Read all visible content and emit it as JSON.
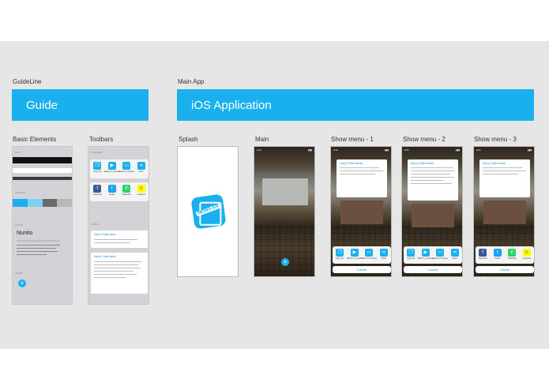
{
  "sections": {
    "guideline_label": "GuideLine",
    "mainapp_label": "Main App"
  },
  "banners": {
    "guide": "Guide",
    "ios": "iOS Application"
  },
  "columns": {
    "basic_elements": "Basic Elements",
    "toolbars": "Toolbars",
    "splash": "Splash",
    "main": "Main",
    "show1": "Show menu - 1",
    "show2": "Show menu - 2",
    "show3": "Show menu - 3"
  },
  "basic": {
    "bar_label": "BAR",
    "colors_label": "COLORS",
    "fonts_label": "FONTS",
    "font_name": "Nunito",
    "font_url": "https://fonts.google.com/specimen/Nunito",
    "icons_label": "ICONS"
  },
  "toolbars": {
    "toolbar_label": "TOOLBAR",
    "items_row1": [
      "Copy link",
      "Watch on youtube",
      "Watch on browser",
      "More"
    ],
    "items_row2": [
      "Facebook",
      "Twitter",
      "WhatsApp",
      "Snapchat"
    ],
    "cards_label": "CARDS",
    "card_title": "Harry Potter actor"
  },
  "splash": {
    "logo_text": "NEWS AR"
  },
  "sheet": {
    "copy_items": [
      "Copy link",
      "Watch on youtube",
      "Watch on browser",
      "Share"
    ],
    "social_items": [
      "Facebook",
      "Twitter",
      "WhatsApp",
      "Snapchat"
    ],
    "cancel": "Cancel",
    "card_title": "Harry Potter Movie"
  },
  "colors": {
    "accent": "#1ab0ee",
    "palette": [
      "#1ab0ee",
      "#7fd0f2",
      "#6a6a6a",
      "#b8b8b8"
    ]
  },
  "icons": {
    "fab": "plus-icon",
    "copy": "copy-icon",
    "youtube": "youtube-icon",
    "browser": "browser-icon",
    "share": "share-icon",
    "facebook": "facebook-icon",
    "twitter": "twitter-icon",
    "whatsapp": "whatsapp-icon",
    "snapchat": "snapchat-icon"
  }
}
